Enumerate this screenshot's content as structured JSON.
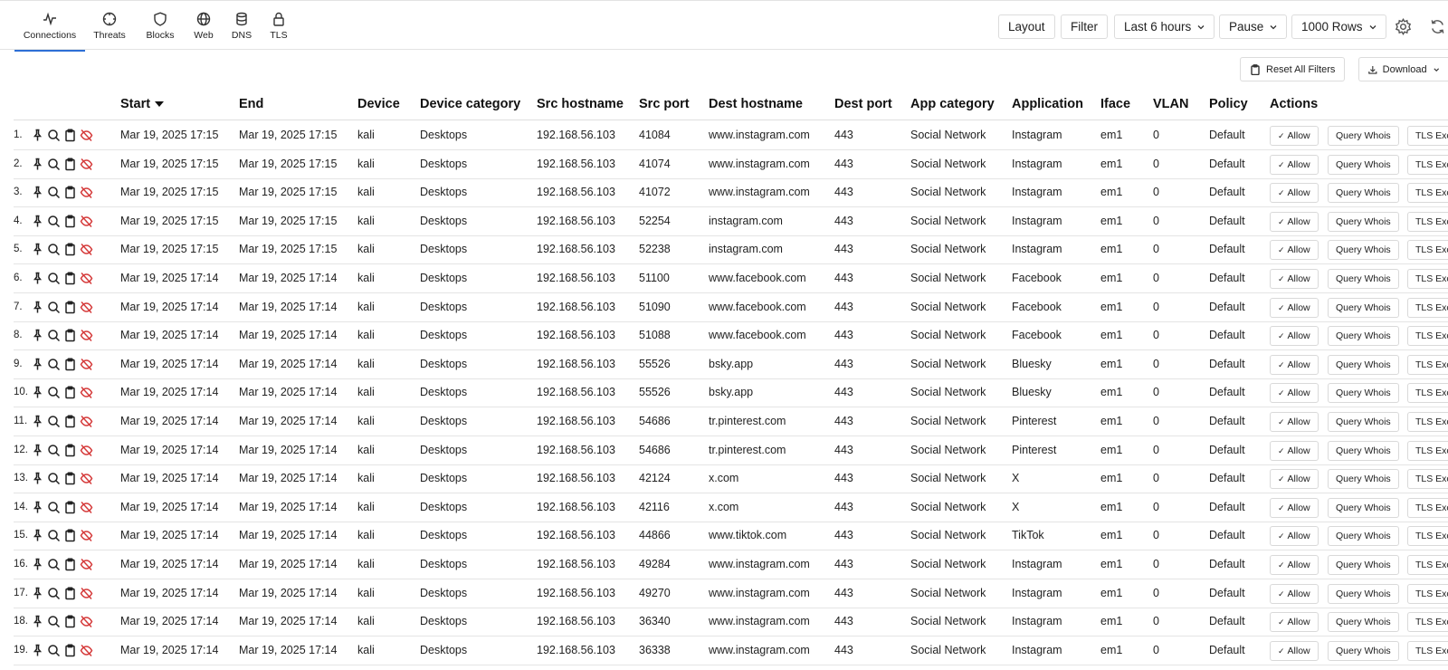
{
  "nav": {
    "tabs": [
      {
        "label": "Connections",
        "icon": "activity-icon",
        "active": true
      },
      {
        "label": "Threats",
        "icon": "crosshair-icon",
        "active": false
      },
      {
        "label": "Blocks",
        "icon": "shield-icon",
        "active": false
      },
      {
        "label": "Web",
        "icon": "globe-icon",
        "active": false
      },
      {
        "label": "DNS",
        "icon": "database-icon",
        "active": false
      },
      {
        "label": "TLS",
        "icon": "lock-icon",
        "active": false
      }
    ]
  },
  "toolbar": {
    "layout_label": "Layout",
    "filter_label": "Filter",
    "time_range": "Last 6 hours",
    "pause_label": "Pause",
    "rows_label": "1000 Rows",
    "reset_filters_label": "Reset All Filters",
    "download_label": "Download"
  },
  "table": {
    "columns": [
      "Start",
      "End",
      "Device",
      "Device category",
      "Src hostname",
      "Src port",
      "Dest hostname",
      "Dest port",
      "App category",
      "Application",
      "Iface",
      "VLAN",
      "Policy",
      "Actions"
    ],
    "sort_column": "Start",
    "sort_direction": "descending",
    "actions": {
      "allow": "Allow",
      "whois": "Query Whois",
      "tls": "TLS Exc"
    },
    "rows": [
      {
        "n": "1.",
        "start": "Mar 19, 2025 17:15",
        "end": "Mar 19, 2025 17:15",
        "device": "kali",
        "devcat": "Desktops",
        "src": "192.168.56.103",
        "sport": "41084",
        "dest": "www.instagram.com",
        "dport": "443",
        "appcat": "Social Network",
        "app": "Instagram",
        "iface": "em1",
        "vlan": "0",
        "policy": "Default"
      },
      {
        "n": "2.",
        "start": "Mar 19, 2025 17:15",
        "end": "Mar 19, 2025 17:15",
        "device": "kali",
        "devcat": "Desktops",
        "src": "192.168.56.103",
        "sport": "41074",
        "dest": "www.instagram.com",
        "dport": "443",
        "appcat": "Social Network",
        "app": "Instagram",
        "iface": "em1",
        "vlan": "0",
        "policy": "Default"
      },
      {
        "n": "3.",
        "start": "Mar 19, 2025 17:15",
        "end": "Mar 19, 2025 17:15",
        "device": "kali",
        "devcat": "Desktops",
        "src": "192.168.56.103",
        "sport": "41072",
        "dest": "www.instagram.com",
        "dport": "443",
        "appcat": "Social Network",
        "app": "Instagram",
        "iface": "em1",
        "vlan": "0",
        "policy": "Default"
      },
      {
        "n": "4.",
        "start": "Mar 19, 2025 17:15",
        "end": "Mar 19, 2025 17:15",
        "device": "kali",
        "devcat": "Desktops",
        "src": "192.168.56.103",
        "sport": "52254",
        "dest": "instagram.com",
        "dport": "443",
        "appcat": "Social Network",
        "app": "Instagram",
        "iface": "em1",
        "vlan": "0",
        "policy": "Default"
      },
      {
        "n": "5.",
        "start": "Mar 19, 2025 17:15",
        "end": "Mar 19, 2025 17:15",
        "device": "kali",
        "devcat": "Desktops",
        "src": "192.168.56.103",
        "sport": "52238",
        "dest": "instagram.com",
        "dport": "443",
        "appcat": "Social Network",
        "app": "Instagram",
        "iface": "em1",
        "vlan": "0",
        "policy": "Default"
      },
      {
        "n": "6.",
        "start": "Mar 19, 2025 17:14",
        "end": "Mar 19, 2025 17:14",
        "device": "kali",
        "devcat": "Desktops",
        "src": "192.168.56.103",
        "sport": "51100",
        "dest": "www.facebook.com",
        "dport": "443",
        "appcat": "Social Network",
        "app": "Facebook",
        "iface": "em1",
        "vlan": "0",
        "policy": "Default"
      },
      {
        "n": "7.",
        "start": "Mar 19, 2025 17:14",
        "end": "Mar 19, 2025 17:14",
        "device": "kali",
        "devcat": "Desktops",
        "src": "192.168.56.103",
        "sport": "51090",
        "dest": "www.facebook.com",
        "dport": "443",
        "appcat": "Social Network",
        "app": "Facebook",
        "iface": "em1",
        "vlan": "0",
        "policy": "Default"
      },
      {
        "n": "8.",
        "start": "Mar 19, 2025 17:14",
        "end": "Mar 19, 2025 17:14",
        "device": "kali",
        "devcat": "Desktops",
        "src": "192.168.56.103",
        "sport": "51088",
        "dest": "www.facebook.com",
        "dport": "443",
        "appcat": "Social Network",
        "app": "Facebook",
        "iface": "em1",
        "vlan": "0",
        "policy": "Default"
      },
      {
        "n": "9.",
        "start": "Mar 19, 2025 17:14",
        "end": "Mar 19, 2025 17:14",
        "device": "kali",
        "devcat": "Desktops",
        "src": "192.168.56.103",
        "sport": "55526",
        "dest": "bsky.app",
        "dport": "443",
        "appcat": "Social Network",
        "app": "Bluesky",
        "iface": "em1",
        "vlan": "0",
        "policy": "Default"
      },
      {
        "n": "10.",
        "start": "Mar 19, 2025 17:14",
        "end": "Mar 19, 2025 17:14",
        "device": "kali",
        "devcat": "Desktops",
        "src": "192.168.56.103",
        "sport": "55526",
        "dest": "bsky.app",
        "dport": "443",
        "appcat": "Social Network",
        "app": "Bluesky",
        "iface": "em1",
        "vlan": "0",
        "policy": "Default"
      },
      {
        "n": "11.",
        "start": "Mar 19, 2025 17:14",
        "end": "Mar 19, 2025 17:14",
        "device": "kali",
        "devcat": "Desktops",
        "src": "192.168.56.103",
        "sport": "54686",
        "dest": "tr.pinterest.com",
        "dport": "443",
        "appcat": "Social Network",
        "app": "Pinterest",
        "iface": "em1",
        "vlan": "0",
        "policy": "Default"
      },
      {
        "n": "12.",
        "start": "Mar 19, 2025 17:14",
        "end": "Mar 19, 2025 17:14",
        "device": "kali",
        "devcat": "Desktops",
        "src": "192.168.56.103",
        "sport": "54686",
        "dest": "tr.pinterest.com",
        "dport": "443",
        "appcat": "Social Network",
        "app": "Pinterest",
        "iface": "em1",
        "vlan": "0",
        "policy": "Default"
      },
      {
        "n": "13.",
        "start": "Mar 19, 2025 17:14",
        "end": "Mar 19, 2025 17:14",
        "device": "kali",
        "devcat": "Desktops",
        "src": "192.168.56.103",
        "sport": "42124",
        "dest": "x.com",
        "dport": "443",
        "appcat": "Social Network",
        "app": "X",
        "iface": "em1",
        "vlan": "0",
        "policy": "Default"
      },
      {
        "n": "14.",
        "start": "Mar 19, 2025 17:14",
        "end": "Mar 19, 2025 17:14",
        "device": "kali",
        "devcat": "Desktops",
        "src": "192.168.56.103",
        "sport": "42116",
        "dest": "x.com",
        "dport": "443",
        "appcat": "Social Network",
        "app": "X",
        "iface": "em1",
        "vlan": "0",
        "policy": "Default"
      },
      {
        "n": "15.",
        "start": "Mar 19, 2025 17:14",
        "end": "Mar 19, 2025 17:14",
        "device": "kali",
        "devcat": "Desktops",
        "src": "192.168.56.103",
        "sport": "44866",
        "dest": "www.tiktok.com",
        "dport": "443",
        "appcat": "Social Network",
        "app": "TikTok",
        "iface": "em1",
        "vlan": "0",
        "policy": "Default"
      },
      {
        "n": "16.",
        "start": "Mar 19, 2025 17:14",
        "end": "Mar 19, 2025 17:14",
        "device": "kali",
        "devcat": "Desktops",
        "src": "192.168.56.103",
        "sport": "49284",
        "dest": "www.instagram.com",
        "dport": "443",
        "appcat": "Social Network",
        "app": "Instagram",
        "iface": "em1",
        "vlan": "0",
        "policy": "Default"
      },
      {
        "n": "17.",
        "start": "Mar 19, 2025 17:14",
        "end": "Mar 19, 2025 17:14",
        "device": "kali",
        "devcat": "Desktops",
        "src": "192.168.56.103",
        "sport": "49270",
        "dest": "www.instagram.com",
        "dport": "443",
        "appcat": "Social Network",
        "app": "Instagram",
        "iface": "em1",
        "vlan": "0",
        "policy": "Default"
      },
      {
        "n": "18.",
        "start": "Mar 19, 2025 17:14",
        "end": "Mar 19, 2025 17:14",
        "device": "kali",
        "devcat": "Desktops",
        "src": "192.168.56.103",
        "sport": "36340",
        "dest": "www.instagram.com",
        "dport": "443",
        "appcat": "Social Network",
        "app": "Instagram",
        "iface": "em1",
        "vlan": "0",
        "policy": "Default"
      },
      {
        "n": "19.",
        "start": "Mar 19, 2025 17:14",
        "end": "Mar 19, 2025 17:14",
        "device": "kali",
        "devcat": "Desktops",
        "src": "192.168.56.103",
        "sport": "36338",
        "dest": "www.instagram.com",
        "dport": "443",
        "appcat": "Social Network",
        "app": "Instagram",
        "iface": "em1",
        "vlan": "0",
        "policy": "Default"
      }
    ]
  },
  "colors": {
    "accent": "#2d6fd6",
    "danger": "#d53b3b",
    "border": "#dcdcdc"
  }
}
